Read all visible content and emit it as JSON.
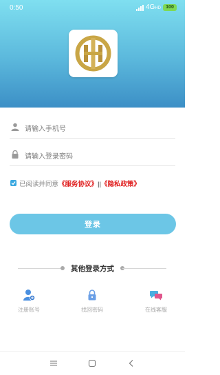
{
  "status_bar": {
    "time": "0:50",
    "network": "4G",
    "network_suffix": "HD",
    "battery": "100"
  },
  "logo": {
    "name": "app-logo",
    "colors": {
      "gold": "#c9a646",
      "gold_dark": "#a8842c"
    }
  },
  "form": {
    "phone_placeholder": "请输入手机号",
    "password_placeholder": "请输入登录密码"
  },
  "agreement": {
    "checked": true,
    "prefix": "已阅读并同意",
    "service_link": "《服务协议》",
    "separator": "||",
    "privacy_link": "《隐私政策》"
  },
  "login_button": {
    "label": "登录"
  },
  "other_login": {
    "title": "其他登录方式",
    "options": [
      {
        "label": "注册账号",
        "icon": "register-user-icon"
      },
      {
        "label": "找回密码",
        "icon": "lock-icon"
      },
      {
        "label": "在线客服",
        "icon": "chat-bubbles-icon"
      }
    ]
  },
  "nav_bar": {
    "icons": [
      "menu-icon",
      "home-square-icon",
      "back-chevron-icon"
    ]
  },
  "colors": {
    "accent": "#6cc6e6",
    "link_red": "#e02020",
    "checkbox": "#3aa8e0"
  }
}
